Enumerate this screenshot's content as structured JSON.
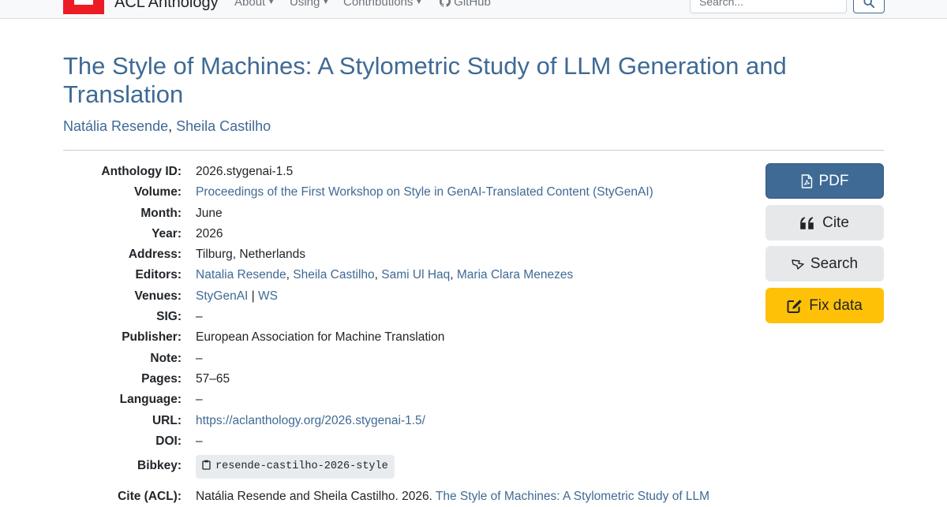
{
  "navbar": {
    "brand": "ACL Anthology",
    "items": [
      {
        "label": "About",
        "has_menu": true
      },
      {
        "label": "Using",
        "has_menu": true
      },
      {
        "label": "Contributions",
        "has_menu": true
      },
      {
        "label": "GitHub",
        "has_menu": false
      }
    ],
    "search_placeholder": "Search..."
  },
  "paper": {
    "title": "The Style of Machines: A Stylometric Study of LLM Generation and Translation",
    "authors": [
      "Natália Resende",
      "Sheila Castilho"
    ]
  },
  "details": {
    "anthology_id": {
      "label": "Anthology ID:",
      "value": "2026.stygenai-1.5"
    },
    "volume": {
      "label": "Volume:",
      "value": "Proceedings of the First Workshop on Style in GenAI-Translated Content (StyGenAI)"
    },
    "month": {
      "label": "Month:",
      "value": "June"
    },
    "year": {
      "label": "Year:",
      "value": "2026"
    },
    "address": {
      "label": "Address:",
      "value": "Tilburg, Netherlands"
    },
    "editors": {
      "label": "Editors:",
      "values": [
        "Natalia Resende",
        "Sheila Castilho",
        "Sami Ul Haq",
        "Maria Clara Menezes"
      ]
    },
    "venues": {
      "label": "Venues:",
      "values": [
        "StyGenAI",
        "WS"
      ],
      "separator": "|"
    },
    "sig": {
      "label": "SIG:",
      "value": "–"
    },
    "publisher": {
      "label": "Publisher:",
      "value": "European Association for Machine Translation"
    },
    "note": {
      "label": "Note:",
      "value": "–"
    },
    "pages": {
      "label": "Pages:",
      "value": "57–65"
    },
    "language": {
      "label": "Language:",
      "value": "–"
    },
    "url": {
      "label": "URL:",
      "value": "https://aclanthology.org/2026.stygenai-1.5/"
    },
    "doi": {
      "label": "DOI:",
      "value": "–"
    },
    "bibkey": {
      "label": "Bibkey:",
      "value": "resende-castilho-2026-style"
    },
    "cite_acl": {
      "label": "Cite (ACL):",
      "text": "Natália Resende and Sheila Castilho. 2026. ",
      "link": "The Style of Machines: A Stylometric Study of LLM"
    }
  },
  "actions": {
    "pdf": "PDF",
    "cite": "Cite",
    "search": "Search",
    "fix": "Fix data"
  },
  "colors": {
    "link": "#3f6a95",
    "brand_red": "#ed1c24",
    "fix_yellow": "#ffc107",
    "secondary_bg": "#e7e8ea"
  }
}
